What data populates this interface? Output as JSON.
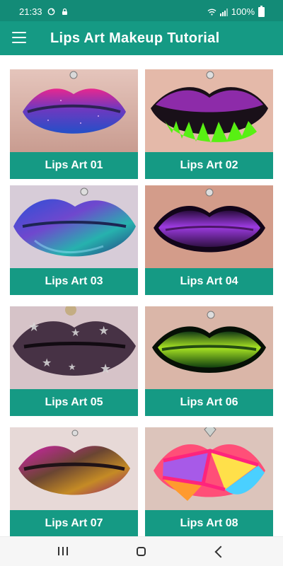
{
  "status_bar": {
    "time": "21:33",
    "battery": "100%",
    "icons": [
      "sync-icon",
      "lock-icon",
      "wifi-icon",
      "signal-icon",
      "battery-icon"
    ]
  },
  "app_bar": {
    "title": "Lips Art Makeup Tutorial",
    "menu_icon": "menu-icon"
  },
  "items": [
    {
      "label": "Lips Art 01",
      "image": "sparkly purple and blue lips"
    },
    {
      "label": "Lips Art 02",
      "image": "purple lips with neon green drips"
    },
    {
      "label": "Lips Art 03",
      "image": "blue green iridescent lips"
    },
    {
      "label": "Lips Art 04",
      "image": "purple glossy lips"
    },
    {
      "label": "Lips Art 05",
      "image": "glitter star lips"
    },
    {
      "label": "Lips Art 06",
      "image": "green glossy lips"
    },
    {
      "label": "Lips Art 07",
      "image": "magenta gold metallic lips"
    },
    {
      "label": "Lips Art 08",
      "image": "colorful geometric lips"
    }
  ],
  "navigation": {
    "recent_apps": "recent-apps-icon",
    "home": "home-icon",
    "back": "back-icon"
  },
  "colors": {
    "primary": "#159a84",
    "status": "#138b77"
  }
}
